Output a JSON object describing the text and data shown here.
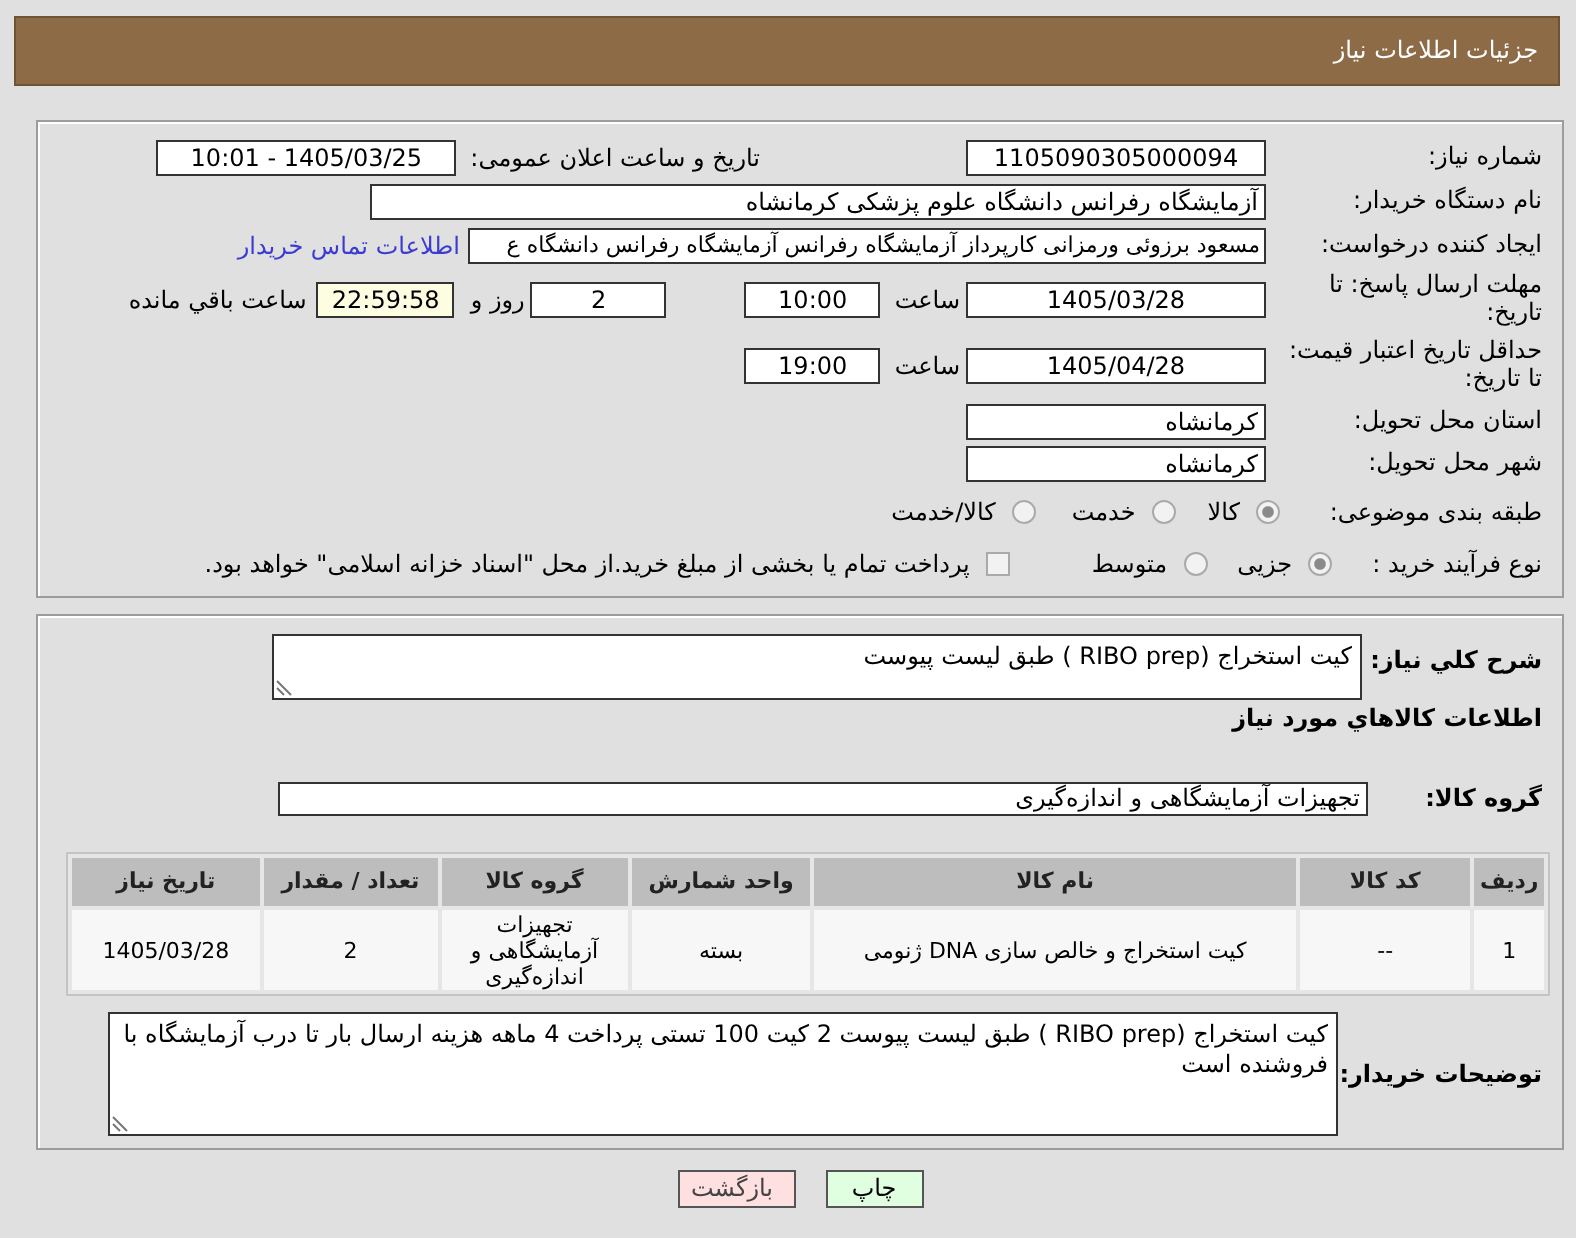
{
  "header": {
    "title": "جزئیات اطلاعات نیاز"
  },
  "details": {
    "need_number": {
      "label": "شماره نیاز:",
      "value": "1105090305000094"
    },
    "announcement": {
      "label": "تاریخ و ساعت اعلان عمومی:",
      "value": "1405/03/25 - 10:01"
    },
    "buyer_org": {
      "label": "نام دستگاه خریدار:",
      "value": "آزمایشگاه رفرانس دانشگاه علوم پزشکی کرمانشاه"
    },
    "requester": {
      "label": "ایجاد کننده درخواست:",
      "value": "مسعود برزوئی ورمزانی کارپرداز آزمایشگاه رفرانس آزمایشگاه رفرانس دانشگاه ع",
      "contact_link": "اطلاعات تماس خریدار"
    },
    "reply_deadline": {
      "label": "مهلت ارسال پاسخ: تا تاریخ:",
      "date": "1405/03/28",
      "time_label": "ساعت",
      "time": "10:00",
      "days": "2",
      "days_label": "روز و",
      "remaining": "22:59:58",
      "remaining_label": "ساعت باقي مانده"
    },
    "price_validity": {
      "label": "حداقل تاریخ اعتبار قیمت: تا تاریخ:",
      "date": "1405/04/28",
      "time_label": "ساعت",
      "time": "19:00"
    },
    "delivery_province": {
      "label": "استان محل تحویل:",
      "value": "کرمانشاه"
    },
    "delivery_city": {
      "label": "شهر محل تحویل:",
      "value": "کرمانشاه"
    },
    "category": {
      "label": "طبقه بندی موضوعی:",
      "options": [
        {
          "label": "کالا",
          "selected": true
        },
        {
          "label": "خدمت",
          "selected": false
        },
        {
          "label": "کالا/خدمت",
          "selected": false
        }
      ]
    },
    "purchase_process": {
      "label": "نوع فرآیند خرید :",
      "options": [
        {
          "label": "جزیی",
          "selected": true
        },
        {
          "label": "متوسط",
          "selected": false
        }
      ],
      "treasury_bonds": {
        "label": "پرداخت تمام یا بخشی از مبلغ خرید.از محل \"اسناد خزانه اسلامی\" خواهد بود.",
        "checked": false
      }
    }
  },
  "requirements": {
    "description": {
      "label": "شرح کلي نیاز:",
      "value": "کیت استخراج (RIBO prep ) طبق لیست پیوست"
    },
    "goods_title": "اطلاعات کالاهاي مورد نیاز",
    "goods_group": {
      "label": "گروه کالا:",
      "value": "تجهیزات آزمایشگاهی و اندازه‌گیری"
    },
    "table": {
      "columns": [
        "ردیف",
        "کد کالا",
        "نام کالا",
        "واحد شمارش",
        "گروه کالا",
        "تعداد / مقدار",
        "تاریخ نیاز"
      ],
      "rows": [
        [
          "1",
          "--",
          "کیت استخراج و خالص سازی DNA ژنومی",
          "بسته",
          "تجهیزات آزمایشگاهی و اندازه‌گیری",
          "2",
          "1405/03/28"
        ]
      ]
    },
    "buyer_notes": {
      "label": "توضیحات خریدار:",
      "value": "کیت استخراج (RIBO prep ) طبق لیست پیوست 2 کیت 100 تستی پرداخت 4 ماهه هزینه ارسال بار تا درب آزمایشگاه با فروشنده است"
    }
  },
  "buttons": [
    {
      "kind": "print",
      "label": "چاپ"
    },
    {
      "kind": "back",
      "label": "بازگشت"
    }
  ]
}
